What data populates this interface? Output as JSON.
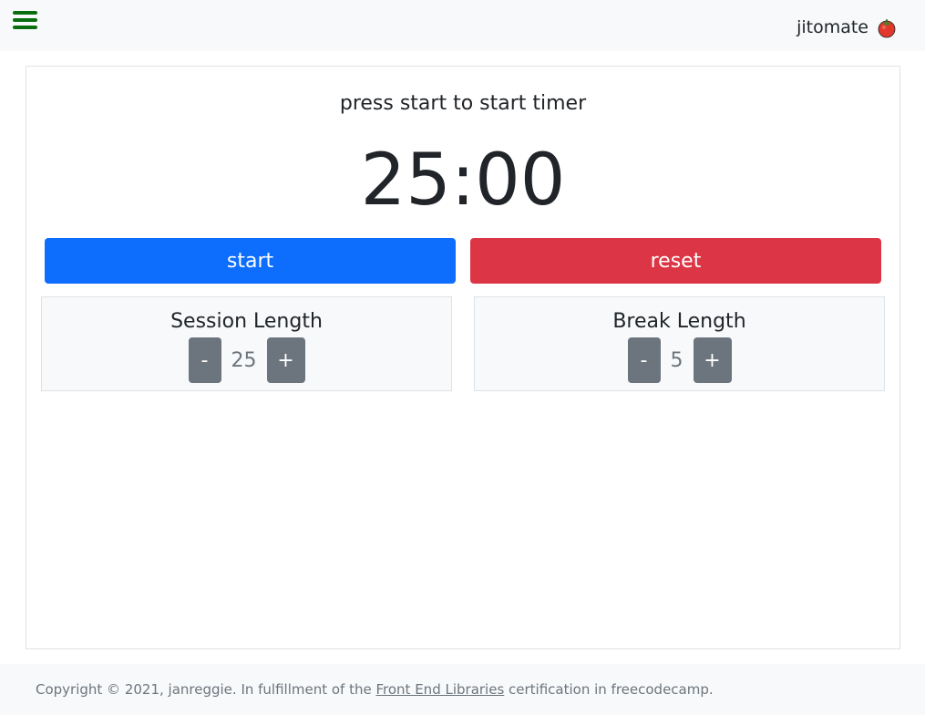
{
  "navbar": {
    "brand": "jitomate",
    "brand_icon": "tomato-icon",
    "menu_icon": "hamburger-menu-icon",
    "menu_color": "#0a6e10"
  },
  "timer": {
    "status": "press start to start timer",
    "display": "25:00"
  },
  "controls": {
    "start_label": "start",
    "reset_label": "reset",
    "start_color": "#0d6efd",
    "reset_color": "#dc3545"
  },
  "session": {
    "title": "Session Length",
    "decrement": "-",
    "value": "25",
    "increment": "+"
  },
  "break": {
    "title": "Break Length",
    "decrement": "-",
    "value": "5",
    "increment": "+"
  },
  "footer": {
    "prefix": "Copyright © 2021, janreggie. In fulfillment of the ",
    "link": "Front End Libraries",
    "suffix": " certification in freecodecamp."
  }
}
